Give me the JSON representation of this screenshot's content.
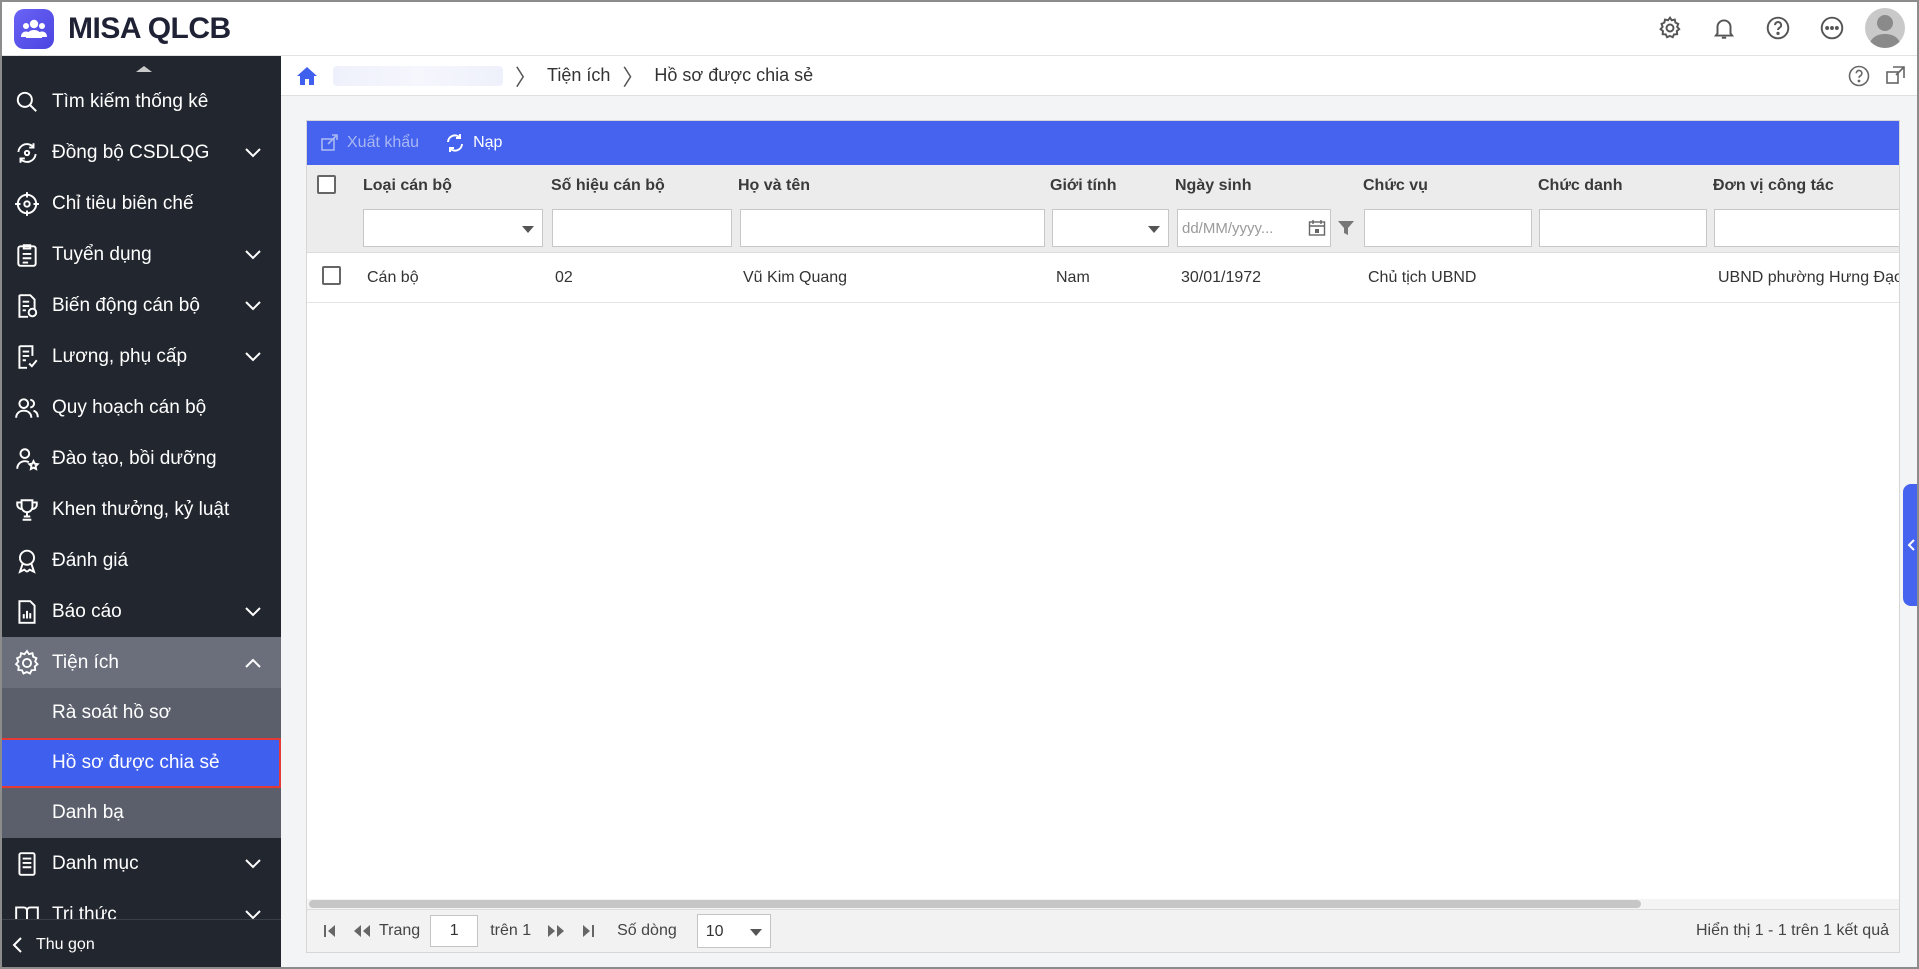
{
  "app": {
    "name": "MISA QLCB"
  },
  "topbar": {
    "icons": [
      "gear-icon",
      "bell-icon",
      "help-icon",
      "more-icon",
      "avatar"
    ]
  },
  "sidebar": {
    "items": [
      {
        "label": "Tìm kiếm thống kê",
        "icon": "search-icon",
        "expandable": false
      },
      {
        "label": "Đồng bộ CSDLQG",
        "icon": "sync-icon",
        "expandable": true
      },
      {
        "label": "Chỉ tiêu biên chế",
        "icon": "target-icon",
        "expandable": false
      },
      {
        "label": "Tuyển dụng",
        "icon": "clipboard-icon",
        "expandable": true
      },
      {
        "label": "Biến động cán bộ",
        "icon": "document-icon",
        "expandable": true
      },
      {
        "label": "Lương, phụ cấp",
        "icon": "payroll-icon",
        "expandable": true
      },
      {
        "label": "Quy hoạch cán bộ",
        "icon": "users-icon",
        "expandable": false
      },
      {
        "label": "Đào tạo, bồi dưỡng",
        "icon": "user-star-icon",
        "expandable": false
      },
      {
        "label": "Khen thưởng, kỷ luật",
        "icon": "trophy-icon",
        "expandable": false
      },
      {
        "label": "Đánh giá",
        "icon": "award-icon",
        "expandable": false
      },
      {
        "label": "Báo cáo",
        "icon": "report-icon",
        "expandable": true
      },
      {
        "label": "Tiện ích",
        "icon": "gear-icon",
        "expandable": true,
        "expanded": true
      }
    ],
    "sub_items": [
      {
        "label": "Rà soát hồ sơ"
      },
      {
        "label": "Hồ sơ được chia sẻ",
        "selected": true
      },
      {
        "label": "Danh bạ"
      }
    ],
    "after_items": [
      {
        "label": "Danh mục",
        "icon": "list-icon",
        "expandable": true
      },
      {
        "label": "Tri thức",
        "icon": "book-icon",
        "expandable": true
      }
    ],
    "collapse_label": "Thu gọn"
  },
  "breadcrumb": {
    "items": [
      "Tiện ích",
      "Hồ sơ được chia sẻ"
    ]
  },
  "toolbar": {
    "export_label": "Xuất khẩu",
    "reload_label": "Nạp"
  },
  "table": {
    "columns": [
      "Loại cán bộ",
      "Số hiệu cán bộ",
      "Họ và tên",
      "Giới tính",
      "Ngày sinh",
      "Chức vụ",
      "Chức danh",
      "Đơn vị công tác"
    ],
    "date_placeholder": "dd/MM/yyyy...",
    "rows": [
      [
        "Cán bộ",
        "02",
        "Vũ Kim Quang",
        "Nam",
        "30/01/1972",
        "Chủ tịch UBND",
        "",
        "UBND phường Hưng Đạo"
      ]
    ]
  },
  "pager": {
    "page_label": "Trang",
    "page_value": "1",
    "of_label": "trên 1",
    "rows_label": "Số dòng",
    "rows_value": "10",
    "summary": "Hiển thị 1 - 1 trên 1 kết quả"
  },
  "colors": {
    "accent": "#4563ee",
    "sidebar_bg": "#22262e",
    "sidebar_active": "#6b6f7c",
    "sidebar_sub": "#5b5f6b",
    "selected_outline": "#e53935"
  }
}
